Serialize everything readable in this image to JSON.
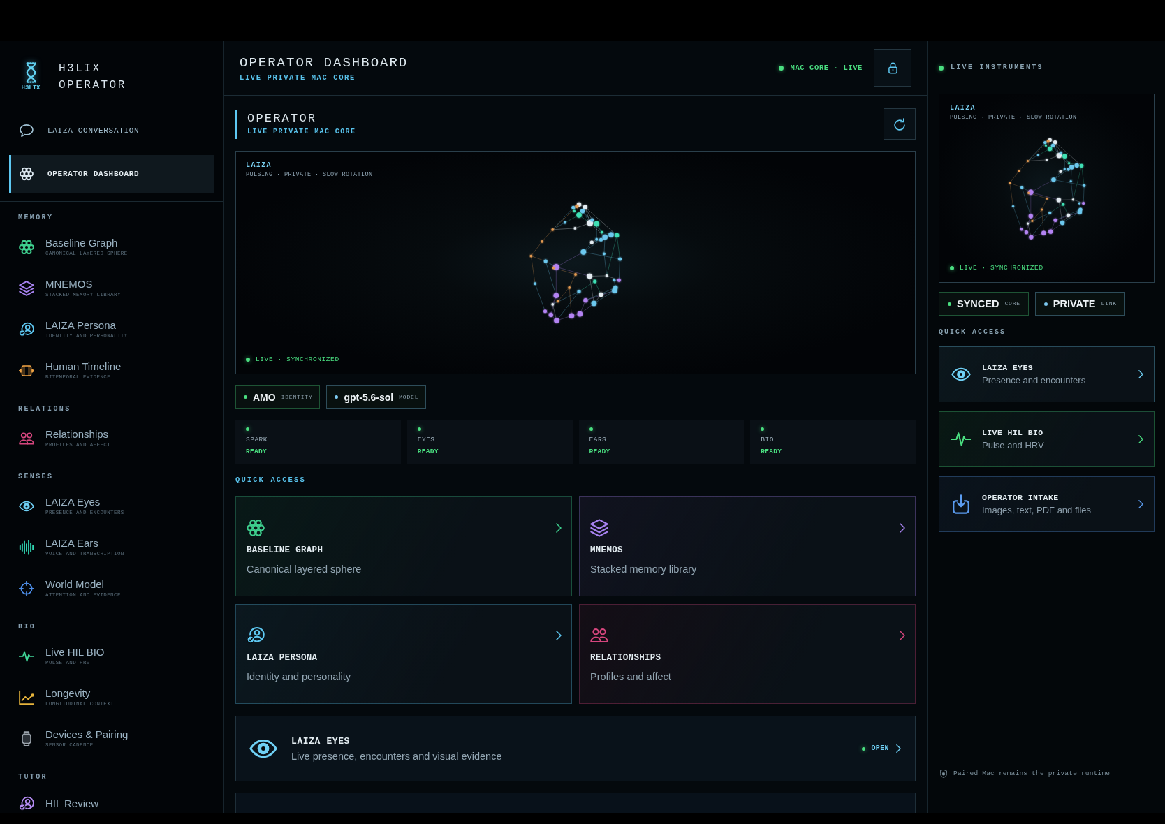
{
  "sidebar": {
    "brand": {
      "logo_text": "H3LIX",
      "title": "H3LIX OPERATOR"
    },
    "nav": [
      {
        "label": "LAIZA CONVERSATION",
        "kind": "chat",
        "selected": false
      },
      {
        "label": "OPERATOR DASHBOARD",
        "kind": "cluster",
        "selected": true
      }
    ],
    "sections": [
      {
        "title": "MEMORY",
        "items": [
          {
            "label": "Baseline Graph",
            "caption": "CANONICAL LAYERED SPHERE",
            "kind": "cluster",
            "color": "#3ecf8e",
            "selected": false
          },
          {
            "label": "MNEMOS",
            "caption": "STACKED MEMORY LIBRARY",
            "kind": "layers",
            "color": "#a782f0",
            "selected": false
          },
          {
            "label": "LAIZA Persona",
            "caption": "IDENTITY AND PERSONALITY",
            "kind": "persona",
            "color": "#5ec8f2",
            "selected": false
          },
          {
            "label": "Human Timeline",
            "caption": "BITEMPORAL EVIDENCE",
            "kind": "timeline",
            "color": "#f2a444",
            "selected": false
          }
        ]
      },
      {
        "title": "RELATIONS",
        "items": [
          {
            "label": "Relationships",
            "caption": "PROFILES AND AFFECT",
            "kind": "people",
            "color": "#d6467e",
            "selected": false
          }
        ]
      },
      {
        "title": "SENSES",
        "items": [
          {
            "label": "LAIZA Eyes",
            "caption": "PRESENCE AND ENCOUNTERS",
            "kind": "eye",
            "color": "#6fd0f5",
            "selected": false
          },
          {
            "label": "LAIZA Ears",
            "caption": "VOICE AND TRANSCRIPTION",
            "kind": "wave",
            "color": "#2fd3b0",
            "selected": false
          },
          {
            "label": "World Model",
            "caption": "ATTENTION AND EVIDENCE",
            "kind": "target",
            "color": "#4c8ce6",
            "selected": false
          }
        ]
      },
      {
        "title": "BIO",
        "items": [
          {
            "label": "Live HIL BIO",
            "caption": "PULSE AND HRV",
            "kind": "pulse",
            "color": "#42d99a",
            "selected": false
          },
          {
            "label": "Longevity",
            "caption": "LONGITUDINAL CONTEXT",
            "kind": "chart",
            "color": "#e6b43c",
            "selected": false
          },
          {
            "label": "Devices & Pairing",
            "caption": "SENSOR CADENCE",
            "kind": "watch",
            "color": "#9aa3ab",
            "selected": false
          }
        ]
      },
      {
        "title": "TUTOR",
        "items": [
          {
            "label": "HIL Review",
            "kind": "persona",
            "color": "#b58cf2",
            "selected": false
          }
        ]
      }
    ]
  },
  "main": {
    "header": {
      "title": "OPERATOR DASHBOARD",
      "subtitle": "LIVE PRIVATE MAC CORE",
      "status": "MAC CORE · LIVE"
    },
    "operator": {
      "title": "OPERATOR",
      "subtitle": "LIVE PRIVATE MAC CORE"
    },
    "viewer": {
      "name": "LAIZA",
      "modes": "PULSING · PRIVATE · SLOW ROTATION",
      "status": "LIVE · SYNCHRONIZED"
    },
    "chips": [
      {
        "value": "AMO",
        "label": "IDENTITY",
        "color": "#4ade80"
      },
      {
        "value": "gpt-5.6-sol",
        "label": "MODEL",
        "color": "#7cc8f0"
      }
    ],
    "subsystems": [
      {
        "name": "SPARK",
        "status": "READY"
      },
      {
        "name": "EYES",
        "status": "READY"
      },
      {
        "name": "EARS",
        "status": "READY"
      },
      {
        "name": "BIO",
        "status": "READY"
      }
    ],
    "quick_access": {
      "title": "QUICK ACCESS",
      "cards": [
        {
          "title": "BASELINE GRAPH",
          "subtitle": "Canonical layered sphere",
          "kind": "cluster",
          "color": "#3ecf8e"
        },
        {
          "title": "MNEMOS",
          "subtitle": "Stacked memory library",
          "kind": "layers",
          "color": "#a782f0"
        },
        {
          "title": "LAIZA PERSONA",
          "subtitle": "Identity and personality",
          "kind": "persona",
          "color": "#5ec8f2"
        },
        {
          "title": "RELATIONSHIPS",
          "subtitle": "Profiles and affect",
          "kind": "people",
          "color": "#d6467e"
        }
      ],
      "feature": {
        "title": "LAIZA EYES",
        "subtitle": "Live presence, encounters and visual evidence",
        "action": "OPEN",
        "kind": "eye"
      }
    }
  },
  "right": {
    "title": "LIVE INSTRUMENTS",
    "viewer": {
      "name": "LAIZA",
      "modes": "PULSING · PRIVATE · SLOW ROTATION",
      "status": "LIVE · SYNCHRONIZED"
    },
    "chips": [
      {
        "value": "SYNCED",
        "label": "CORE",
        "color": "#4ade80"
      },
      {
        "value": "PRIVATE",
        "label": "LINK",
        "color": "#7cc8f0"
      }
    ],
    "quick_access": {
      "title": "QUICK ACCESS",
      "cards": [
        {
          "title": "LAIZA EYES",
          "subtitle": "Presence and encounters",
          "kind": "eye",
          "color": "#6fd0f5"
        },
        {
          "title": "LIVE HIL BIO",
          "subtitle": "Pulse and HRV",
          "kind": "pulse",
          "color": "#4ade80"
        },
        {
          "title": "OPERATOR INTAKE",
          "subtitle": "Images, text, PDF and files",
          "kind": "intake",
          "color": "#5b9cf0"
        }
      ]
    },
    "footer": "Paired Mac remains the private runtime"
  }
}
